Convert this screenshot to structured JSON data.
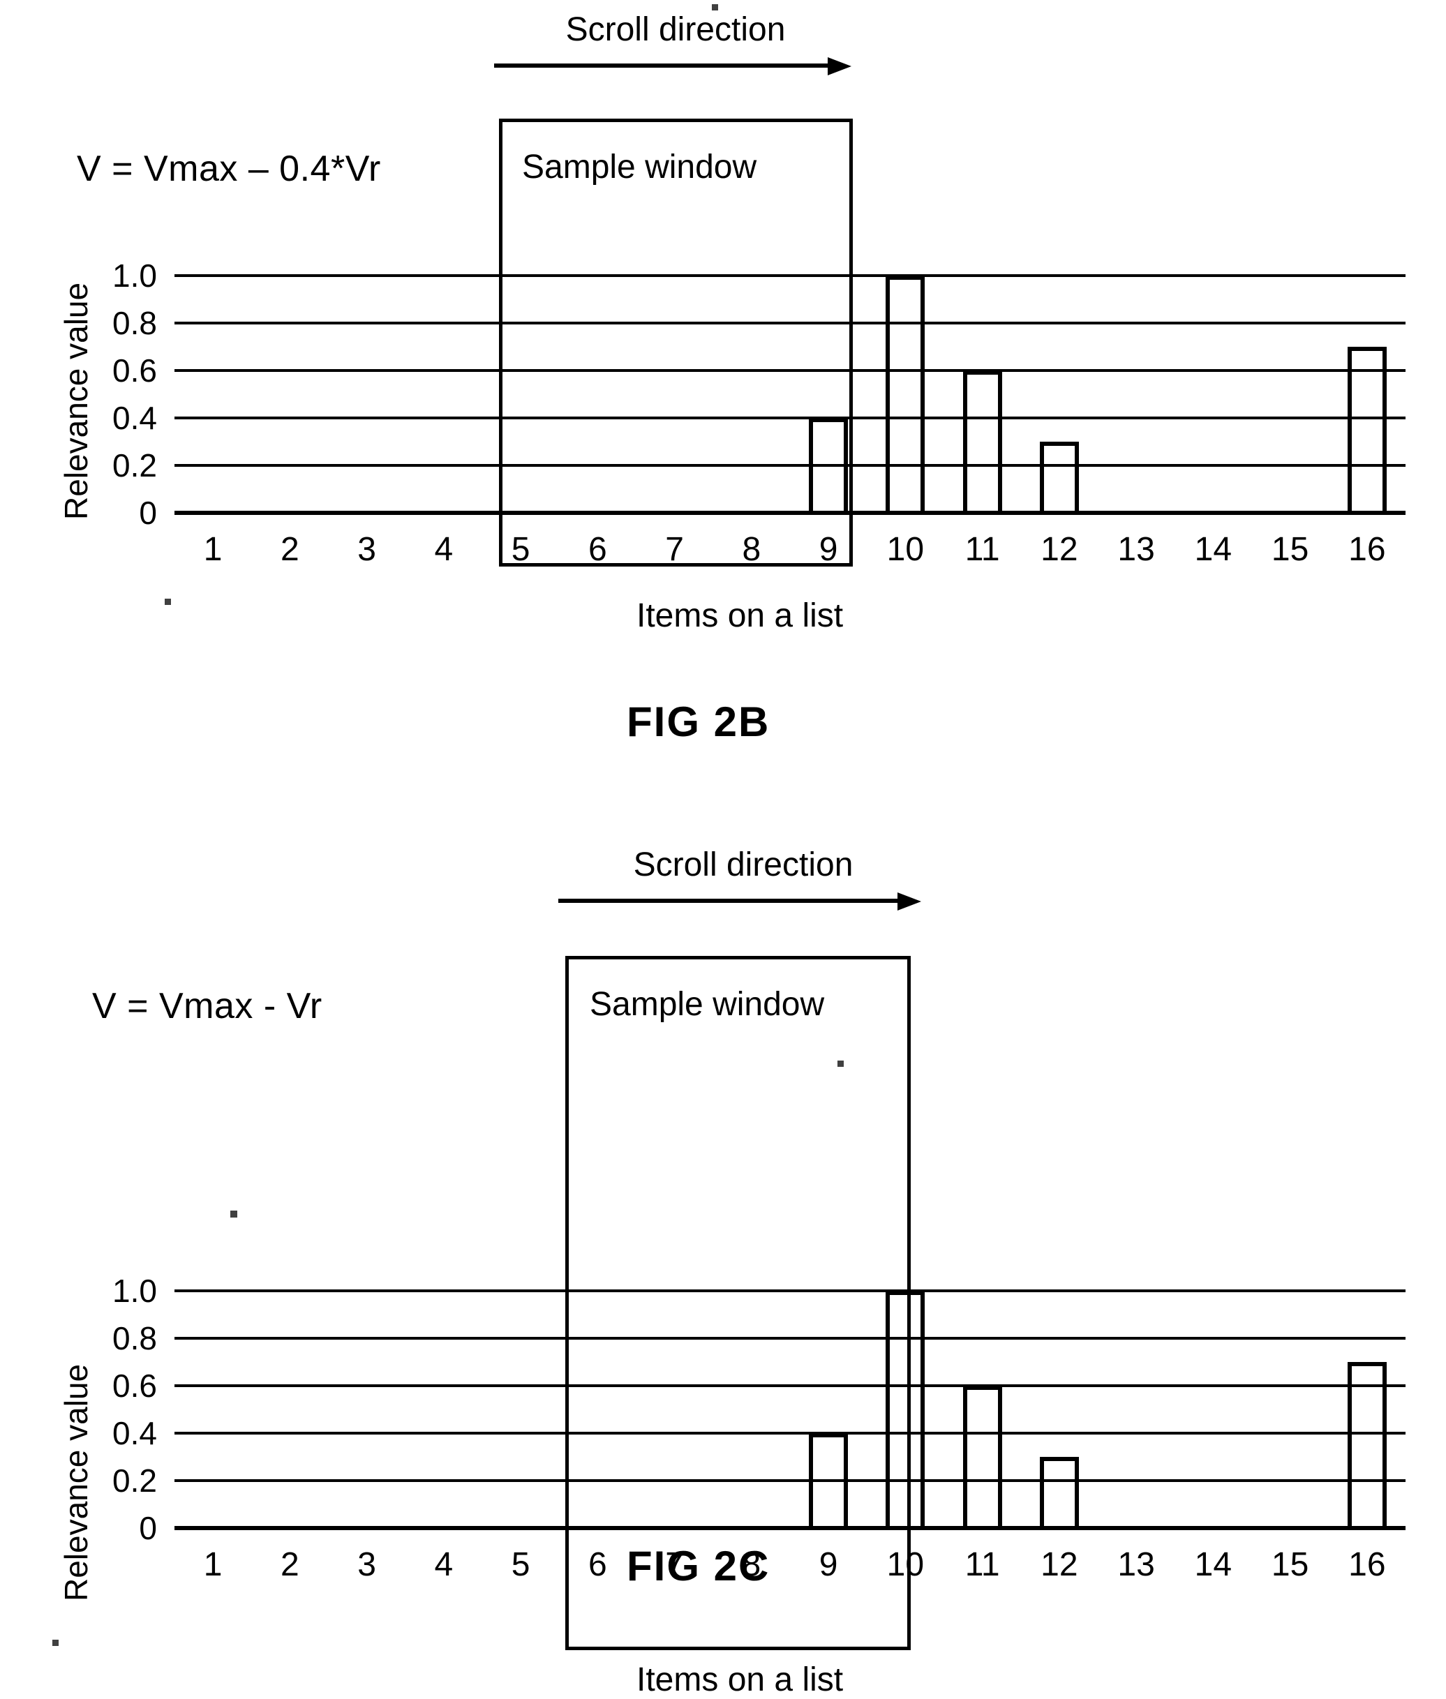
{
  "figures": [
    {
      "id": "fig-2b",
      "caption": "FIG 2B",
      "formula": "V = Vmax – 0.4*Vr",
      "scroll_label": "Scroll direction",
      "sample_window_label": "Sample window",
      "sample_window_items": [
        5,
        6,
        7,
        8,
        9
      ],
      "chart_data": {
        "type": "bar",
        "title": "",
        "xlabel": "Items on a list",
        "ylabel": "Relevance value",
        "categories": [
          "1",
          "2",
          "3",
          "4",
          "5",
          "6",
          "7",
          "8",
          "9",
          "10",
          "11",
          "12",
          "13",
          "14",
          "15",
          "16"
        ],
        "values": [
          0,
          0,
          0,
          0,
          0,
          0,
          0,
          0,
          0.4,
          1.0,
          0.6,
          0.3,
          0,
          0,
          0,
          0.7
        ],
        "ylim": [
          0,
          1.0
        ],
        "yticks": [
          "1.0",
          "0.8",
          "0.6",
          "0.4",
          "0.2",
          "0"
        ],
        "ytick_values": [
          1.0,
          0.8,
          0.6,
          0.4,
          0.2,
          0
        ],
        "grid": true,
        "legend": "none"
      }
    },
    {
      "id": "fig-2c",
      "caption": "FIG 2C",
      "formula": "V = Vmax - Vr",
      "scroll_label": "Scroll direction",
      "sample_window_label": "Sample window",
      "sample_window_items": [
        6,
        7,
        8,
        9,
        10
      ],
      "chart_data": {
        "type": "bar",
        "title": "",
        "xlabel": "Items on a list",
        "ylabel": "Relevance value",
        "categories": [
          "1",
          "2",
          "3",
          "4",
          "5",
          "6",
          "7",
          "8",
          "9",
          "10",
          "11",
          "12",
          "13",
          "14",
          "15",
          "16"
        ],
        "values": [
          0,
          0,
          0,
          0,
          0,
          0,
          0,
          0,
          0.4,
          1.0,
          0.6,
          0.3,
          0,
          0,
          0,
          0.7
        ],
        "ylim": [
          0,
          1.0
        ],
        "yticks": [
          "1.0",
          "0.8",
          "0.6",
          "0.4",
          "0.2",
          "0"
        ],
        "ytick_values": [
          1.0,
          0.8,
          0.6,
          0.4,
          0.2,
          0
        ],
        "grid": true,
        "legend": "none"
      }
    }
  ]
}
